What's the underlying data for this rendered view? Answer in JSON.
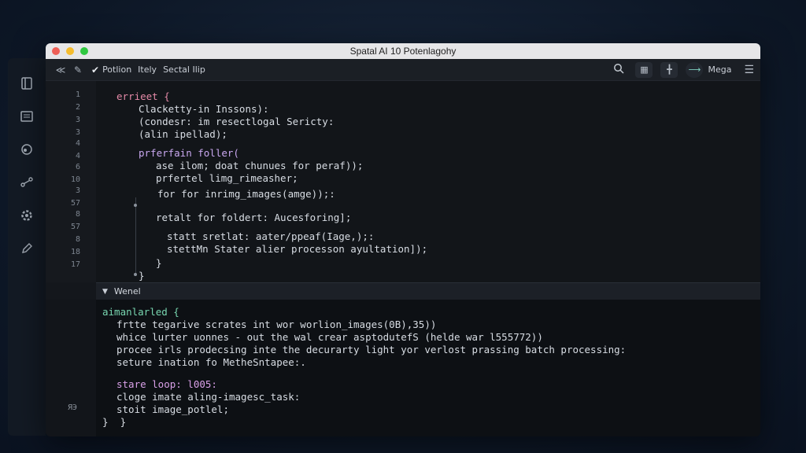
{
  "window": {
    "title": "Spatal AI 10 Potenlagohy"
  },
  "toolbar": {
    "menu": [
      "Potlion",
      "Itely",
      "Sectal Ilip"
    ],
    "user": "Mega"
  },
  "editor": {
    "line_numbers": [
      "1",
      "2",
      "3",
      "3",
      "4",
      "4",
      "6",
      "10",
      "3",
      "57",
      "8",
      "57",
      "8",
      "18",
      "17"
    ],
    "lines": [
      "errieet {",
      "Clacketty-in Inssons):",
      "(condesr: im resectlogal Sericty:",
      "(alin ipellad);",
      "prferfain foller(",
      "ase ilom; doat chunues for peraf));",
      "prfertel limg_rimeasher;",
      "for for inrimg_images(amge));:",
      "retalt for foldert: Aucesforing];",
      "statt sretlat: aater/ppeaf(Iage,);:",
      "stettMn Stater alier processon ayultation]);",
      "}",
      "}"
    ]
  },
  "panel": {
    "title": "Wenel"
  },
  "terminal": {
    "lines": [
      "aimanlarled {",
      "frtte tegarive scrates int wor worlion_images(0B),35))",
      "whice lurter uonnes - out the wal crear asptodutefS (helde war l555772))",
      "procee irls prodecsing inte the decurarty light yor verlost prassing batch processing:",
      "seture ination fo MetheSntapee:.",
      "stare loop: l005:",
      "cloge imate aling-imagesc_task:",
      "stoit image_potlel;",
      "}  }"
    ],
    "gutter_marker": "ЯЭ"
  }
}
